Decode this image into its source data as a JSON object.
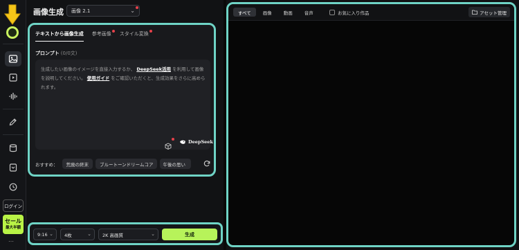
{
  "sidebar": {
    "nav": [
      {
        "icon": "image-icon",
        "active": true
      },
      {
        "icon": "video-icon",
        "active": false
      },
      {
        "icon": "audio-wave-icon",
        "active": false
      },
      {
        "icon": "edit-tag-icon",
        "active": false
      },
      {
        "icon": "cylinder-icon",
        "active": false
      },
      {
        "icon": "template-icon",
        "active": false
      },
      {
        "icon": "history-icon",
        "active": false
      }
    ],
    "login_label": "ログイン",
    "sale_label": "セール",
    "sale_sub_label": "最大半額",
    "more_label": "…"
  },
  "header": {
    "title": "画像生成",
    "model_value": "画像 2.1"
  },
  "left_panel": {
    "tabs": [
      {
        "label": "テキストから画像生成",
        "active": true,
        "dot": false
      },
      {
        "label": "参考画像",
        "active": false,
        "dot": true
      },
      {
        "label": "スタイル変換",
        "active": false,
        "dot": true
      }
    ],
    "prompt_label": "プロンプト",
    "prompt_count": "(0/0文)",
    "prompt_text_1": "生成したい画像のイメージを直接入力するか、",
    "prompt_link_1": "DeepSeek活用",
    "prompt_text_2": "を利用して画像を説明してください。",
    "prompt_link_2": "使用ガイド",
    "prompt_text_3": "をご確認いただくと、生成効果をさらに高められます。",
    "deepseek_label": "DeepSeek",
    "suggest_label": "おすすめ：",
    "suggestions": [
      "荒廃の終末",
      "ブルートーンドリームコア",
      "午後の思い"
    ]
  },
  "bottom_bar": {
    "ratio": "9:16",
    "count": "4枚",
    "quality": "2K 高画質",
    "generate_label": "生成"
  },
  "right_panel": {
    "filter_tabs": [
      {
        "label": "すべて",
        "active": true
      },
      {
        "label": "画像",
        "active": false
      },
      {
        "label": "動画",
        "active": false
      },
      {
        "label": "音声",
        "active": false
      }
    ],
    "favorites_label": "お気に入り作品",
    "asset_label": "アセット管理"
  },
  "colors": {
    "accent_green": "#b7f35a",
    "highlight_teal": "#6fd4c6",
    "arrow_yellow": "#f5c518",
    "notification_red": "#e6414a"
  }
}
